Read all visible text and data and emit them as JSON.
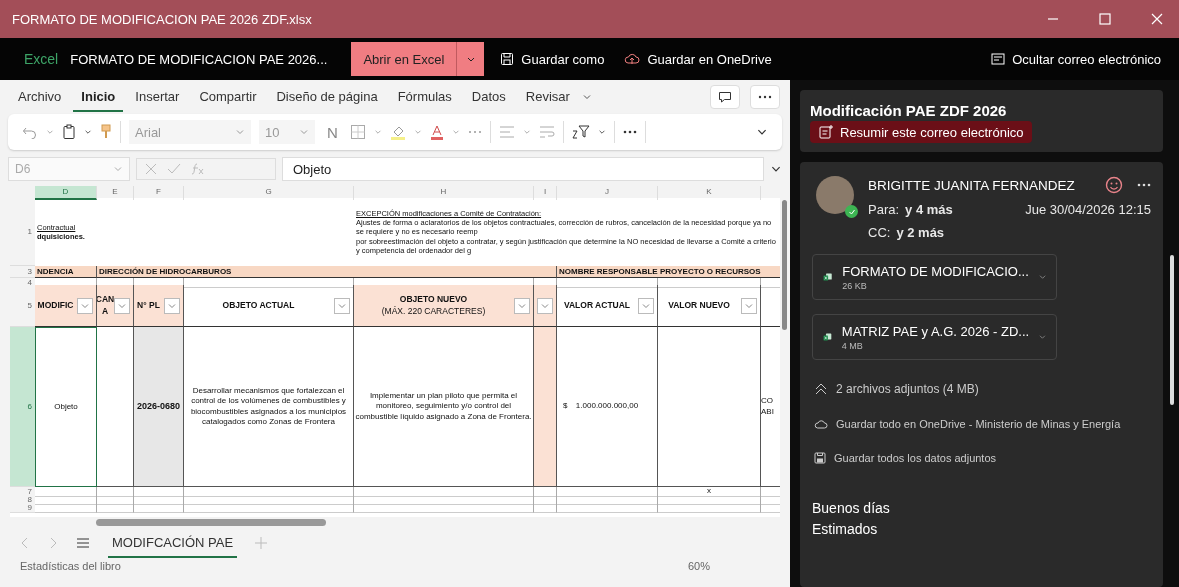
{
  "window": {
    "title": "FORMATO DE MODIFICACION PAE 2026 ZDF.xlsx"
  },
  "app_bar": {
    "app_name": "Excel",
    "file_name": "FORMATO DE MODIFICACION PAE 2026...",
    "open_button": "Abrir en Excel",
    "save_as": "Guardar como",
    "save_onedrive": "Guardar en OneDrive",
    "hide_email": "Ocultar correo electrónico"
  },
  "ribbon": {
    "tabs": [
      {
        "label": "Archivo",
        "selected": false
      },
      {
        "label": "Inicio",
        "selected": true
      },
      {
        "label": "Insertar",
        "selected": false
      },
      {
        "label": "Compartir",
        "selected": false
      },
      {
        "label": "Diseño de página",
        "selected": false
      },
      {
        "label": "Fórmulas",
        "selected": false
      },
      {
        "label": "Datos",
        "selected": false
      },
      {
        "label": "Revisar",
        "selected": false
      }
    ],
    "font": "Arial",
    "size": "10",
    "bold_glyph": "N"
  },
  "formula_bar": {
    "cell": "D6",
    "value": "Objeto"
  },
  "sheet": {
    "columns": [
      {
        "label": "D",
        "selected": true
      },
      {
        "label": "E",
        "selected": false
      },
      {
        "label": "F",
        "selected": false
      },
      {
        "label": "G",
        "selected": false
      },
      {
        "label": "H",
        "selected": false
      },
      {
        "label": "I",
        "selected": false
      },
      {
        "label": "J",
        "selected": false
      },
      {
        "label": "K",
        "selected": false
      }
    ],
    "rows": [
      {
        "kind": "note",
        "number": "1",
        "cells": [
          {
            "lines": [
              "Contractual",
              "**dquisiciones.**"
            ]
          },
          {},
          {},
          {},
          {
            "lines": [
              "EXCEPCIÓN modificaciones a Comité de Contratación:",
              "Ajustes de forma o aclaratorios de los objetos contractuales, corrección de rubros, cancelación de la necesidad porque ya no se requiere y no es necesario reemp",
              "por sobreestimación del objeto a contratar, y según justificación que determine la NO necesidad de llevarse a Comité a criterio y competencia del ordenador del g"
            ]
          },
          {},
          {},
          {},
          {}
        ]
      },
      {
        "kind": "band",
        "number": "3",
        "cells": [
          {
            "text": "NDENCIA"
          },
          {
            "text": "DIRECCIÓN DE HIDROCARBUROS"
          },
          {},
          {},
          {},
          {},
          {
            "text": "NOMBRE RESPONSABLE PROYECTO O RECURSOS"
          },
          {},
          {}
        ]
      },
      {
        "kind": "blank",
        "number": "4",
        "cells": [
          {},
          {},
          {},
          {},
          {},
          {},
          {},
          {},
          {}
        ]
      },
      {
        "kind": "header",
        "number": "5",
        "cells": [
          {
            "text": "MODIFIC",
            "shaded": true,
            "filter": true
          },
          {
            "text": "CAN A",
            "shaded": true,
            "filter": true
          },
          {
            "text": "N° PL",
            "shaded": true,
            "filter": true
          },
          {
            "text": "OBJETO ACTUAL",
            "shaded": false,
            "filter": true
          },
          {
            "lines": [
              "OBJETO NUEVO",
              "(MÁX. 220 CARACTERES)"
            ],
            "shaded": true,
            "filter": true
          },
          {
            "shaded": true,
            "filter": true
          },
          {
            "text": "VALOR ACTUAL",
            "shaded": false,
            "filter": true
          },
          {
            "text": "VALOR NUEVO",
            "shaded": false,
            "filter": true
          },
          {
            "shaded": false
          }
        ]
      },
      {
        "kind": "data",
        "number": "6",
        "cells": [
          {
            "text": "Objeto",
            "selected": true
          },
          {},
          {
            "text": "2026-0680",
            "shaded": true
          },
          {
            "text": "Desarrollar mecanismos que fortalezcan el control de los volúmenes de combustibles y biocombustibles asignados a los municipios catalogados como Zonas de Frontera"
          },
          {
            "text": "Implementar un plan piloto que permita el monitoreo, seguimiento y/o control del combustible líquido asignado a Zona de Frontera."
          },
          {
            "shaded": true
          },
          {
            "currency": "$",
            "text": "1.000.000.000,00"
          },
          {},
          {
            "lines": [
              "CO",
              "ABI"
            ]
          }
        ]
      },
      {
        "kind": "small",
        "number": "7",
        "cells": [
          {},
          {},
          {},
          {},
          {},
          {},
          {},
          {
            "text": "x"
          },
          {}
        ]
      },
      {
        "kind": "small",
        "number": "8",
        "cells": [
          {},
          {},
          {},
          {},
          {},
          {},
          {},
          {},
          {}
        ]
      },
      {
        "kind": "small",
        "number": "9",
        "cells": [
          {},
          {},
          {},
          {},
          {},
          {},
          {},
          {},
          {}
        ]
      }
    ]
  },
  "sheet_tabs": [
    {
      "label": "MODIFCACIÓN PAE",
      "selected": true
    }
  ],
  "status_bar": {
    "left": "Estadísticas del libro",
    "zoom": "60%"
  },
  "email": {
    "subject": "Modificación PAE ZDF 2026",
    "summarize": "Resumir este correo electrónico",
    "sender": "BRIGITTE JUANITA FERNANDEZ",
    "online": true,
    "to_label": "Para:",
    "to_value": "y 4 más",
    "date": "Jue 30/04/2026 12:15",
    "cc_label": "CC:",
    "cc_value": "y 2 más",
    "attachments": [
      {
        "name": "FORMATO DE MODIFICACIO...",
        "size": "26 KB"
      },
      {
        "name": "MATRIZ PAE y A.G. 2026 - ZD...",
        "size": "4 MB"
      }
    ],
    "attachments_summary": "2 archivos adjuntos (4 MB)",
    "save_onedrive": "Guardar todo en OneDrive - Ministerio de Minas y Energía",
    "save_all": "Guardar todos los datos adjuntos",
    "body": [
      "Buenos días",
      "Estimados"
    ]
  }
}
